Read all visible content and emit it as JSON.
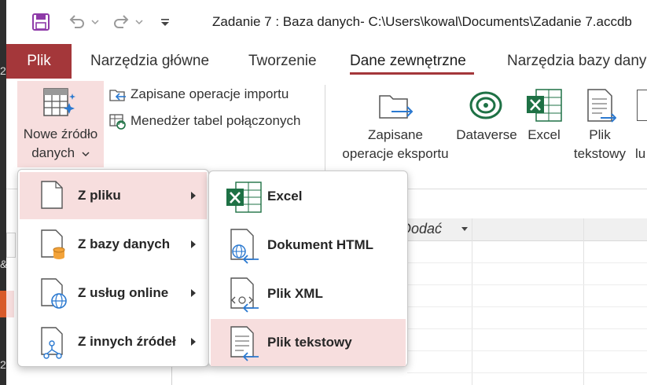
{
  "title_bar": {
    "title": "Zadanie 7 : Baza danych- C:\\Users\\kowal\\Documents\\Zadanie 7.accdb"
  },
  "ribbon_tabs": [
    {
      "label": "Plik"
    },
    {
      "label": "Narzędzia główne"
    },
    {
      "label": "Tworzenie"
    },
    {
      "label": "Dane zewnętrzne"
    },
    {
      "label": "Narzędzia bazy dany"
    }
  ],
  "ribbon": {
    "new_source_line1": "Nowe źródło",
    "new_source_line2": "danych",
    "saved_imports": "Zapisane operacje importu",
    "linked_table_manager": "Menedżer tabel połączonych",
    "saved_exports_line1": "Zapisane",
    "saved_exports_line2": "operacje eksportu",
    "dataverse": "Dataverse",
    "excel": "Excel",
    "text_file_line1": "Plik",
    "text_file_line2": "tekstowy",
    "cut_label": "lu"
  },
  "grid": {
    "column_header": "Dodać"
  },
  "left_strip": [
    "2",
    "&",
    "2"
  ],
  "source_menu": {
    "items": [
      {
        "label": "Z pliku",
        "highlighted": true
      },
      {
        "label": "Z bazy danych",
        "highlighted": false
      },
      {
        "label": "Z usług online",
        "highlighted": false
      },
      {
        "label": "Z innych źródeł",
        "highlighted": false
      }
    ]
  },
  "file_submenu": {
    "items": [
      {
        "label": "Excel",
        "highlighted": false
      },
      {
        "label": "Dokument HTML",
        "highlighted": false
      },
      {
        "label": "Plik XML",
        "highlighted": false
      },
      {
        "label": "Plik tekstowy",
        "highlighted": true
      }
    ]
  },
  "colors": {
    "accent": "#a4373a",
    "highlight": "#f7dede",
    "excel_green": "#1e7145",
    "link_blue": "#2b79d0"
  }
}
